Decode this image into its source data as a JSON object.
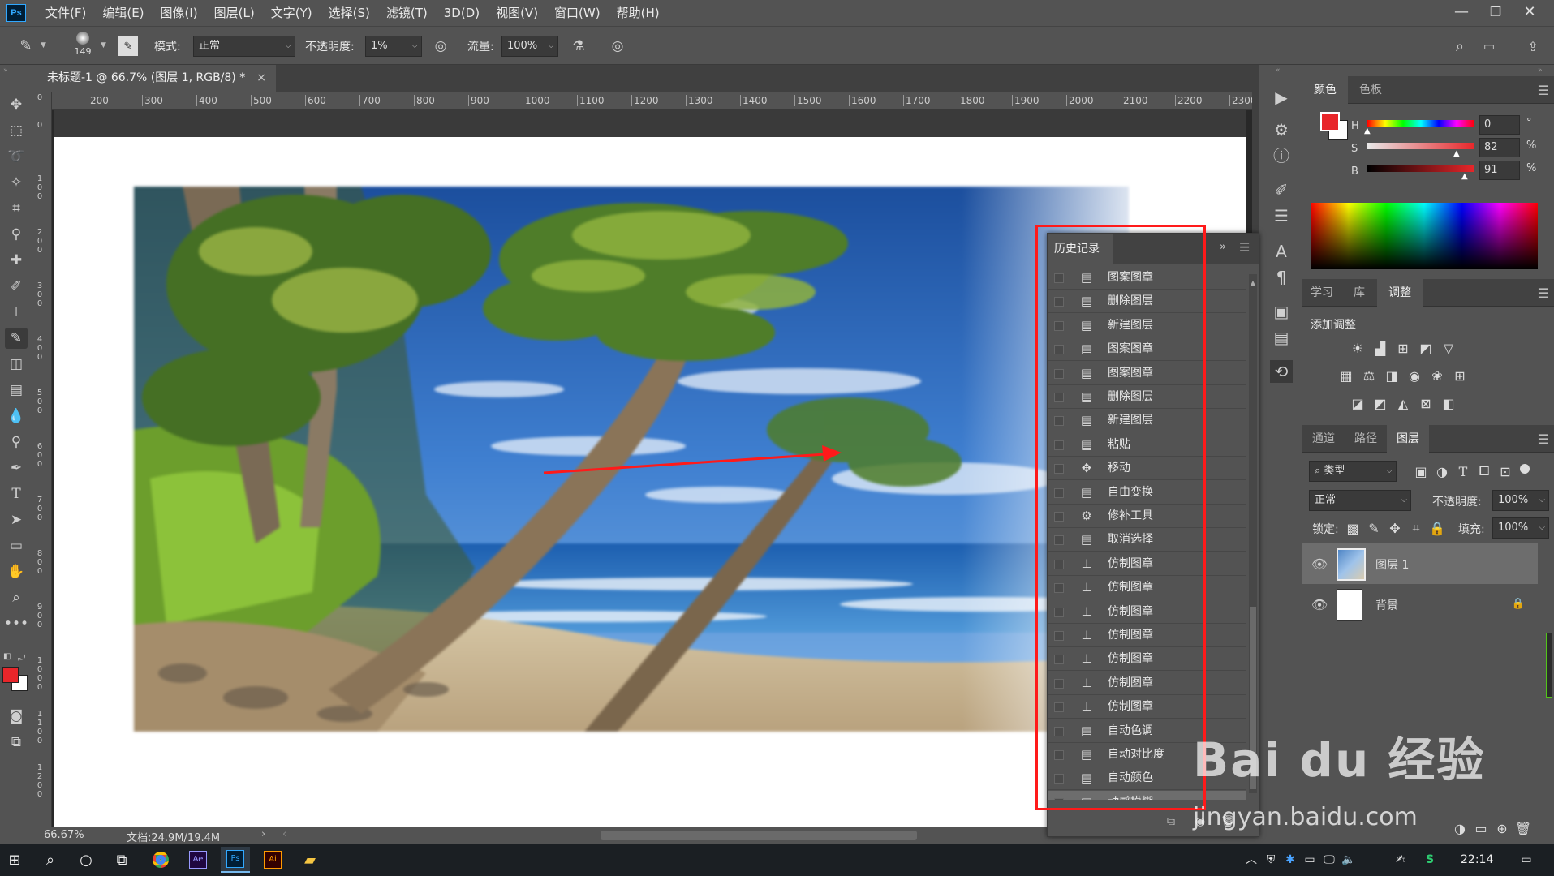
{
  "app": {
    "logo": "Ps",
    "title": ""
  },
  "menu": [
    "文件(F)",
    "编辑(E)",
    "图像(I)",
    "图层(L)",
    "文字(Y)",
    "选择(S)",
    "滤镜(T)",
    "3D(D)",
    "视图(V)",
    "窗口(W)",
    "帮助(H)"
  ],
  "window_controls": [
    "minimize-icon",
    "restore-icon",
    "close-icon"
  ],
  "options": {
    "brush_size": "149",
    "mode_label": "模式:",
    "mode_value": "正常",
    "opacity_label": "不透明度:",
    "opacity_value": "1%",
    "flow_label": "流量:",
    "flow_value": "100%"
  },
  "document": {
    "tab_title": "未标题-1 @ 66.7% (图层 1, RGB/8) *",
    "close": "×",
    "zoom": "66.67%",
    "doc_size": "文档:24.9M/19.4M",
    "ruler_h": [
      "200",
      "300",
      "400",
      "500",
      "600",
      "700",
      "800",
      "900",
      "1000",
      "1100",
      "1200",
      "1300",
      "1400",
      "1500",
      "1600",
      "1700",
      "1800",
      "1900",
      "2000",
      "2100",
      "2200",
      "2300"
    ],
    "ruler_v": [
      "0",
      "0",
      "1 0 0",
      "2 0 0",
      "3 0 0",
      "4 0 0",
      "5 0 0",
      "6 0 0",
      "7 0 0",
      "8 0 0",
      "9 0 0",
      "1 0 0 0",
      "1 1 0 0",
      "1 2 0 0"
    ]
  },
  "colors": {
    "foreground": "#e8262a",
    "background": "#ffffff",
    "annotation_red": "#ff1a1a"
  },
  "color_panel": {
    "tabs": [
      "颜色",
      "色板"
    ],
    "h_label": "H",
    "h_value": "0",
    "h_unit": "°",
    "s_label": "S",
    "s_value": "82",
    "s_unit": "%",
    "b_label": "B",
    "b_value": "91",
    "b_unit": "%"
  },
  "adjust_panel": {
    "tabs": [
      "学习",
      "库",
      "调整"
    ],
    "heading": "添加调整"
  },
  "layers_panel": {
    "tabs": [
      "通道",
      "路径",
      "图层"
    ],
    "filter_label": "类型",
    "blend_mode": "正常",
    "opacity_label": "不透明度:",
    "opacity_value": "100%",
    "lock_label": "锁定:",
    "fill_label": "填充:",
    "fill_value": "100%",
    "layers": [
      {
        "name": "图层 1",
        "visible": true,
        "selected": true
      },
      {
        "name": "背景",
        "visible": true,
        "locked": true
      }
    ]
  },
  "history_panel": {
    "title": "历史记录",
    "items": [
      {
        "label": "图案图章",
        "icon": "document-icon"
      },
      {
        "label": "删除图层",
        "icon": "document-icon"
      },
      {
        "label": "新建图层",
        "icon": "document-icon"
      },
      {
        "label": "图案图章",
        "icon": "document-icon"
      },
      {
        "label": "图案图章",
        "icon": "document-icon"
      },
      {
        "label": "删除图层",
        "icon": "document-icon"
      },
      {
        "label": "新建图层",
        "icon": "document-icon"
      },
      {
        "label": "粘贴",
        "icon": "document-icon"
      },
      {
        "label": "移动",
        "icon": "move-icon"
      },
      {
        "label": "自由变换",
        "icon": "document-icon"
      },
      {
        "label": "修补工具",
        "icon": "patch-icon"
      },
      {
        "label": "取消选择",
        "icon": "document-icon"
      },
      {
        "label": "仿制图章",
        "icon": "stamp-icon"
      },
      {
        "label": "仿制图章",
        "icon": "stamp-icon"
      },
      {
        "label": "仿制图章",
        "icon": "stamp-icon"
      },
      {
        "label": "仿制图章",
        "icon": "stamp-icon"
      },
      {
        "label": "仿制图章",
        "icon": "stamp-icon"
      },
      {
        "label": "仿制图章",
        "icon": "stamp-icon"
      },
      {
        "label": "仿制图章",
        "icon": "stamp-icon"
      },
      {
        "label": "自动色调",
        "icon": "document-icon"
      },
      {
        "label": "自动对比度",
        "icon": "document-icon"
      },
      {
        "label": "自动颜色",
        "icon": "document-icon"
      },
      {
        "label": "动感模糊",
        "icon": "document-icon",
        "selected": true
      }
    ]
  },
  "taskbar": {
    "time": "22:14"
  },
  "watermark": {
    "brand": "Bai du 经验",
    "url": "jingyan.baidu.com"
  }
}
